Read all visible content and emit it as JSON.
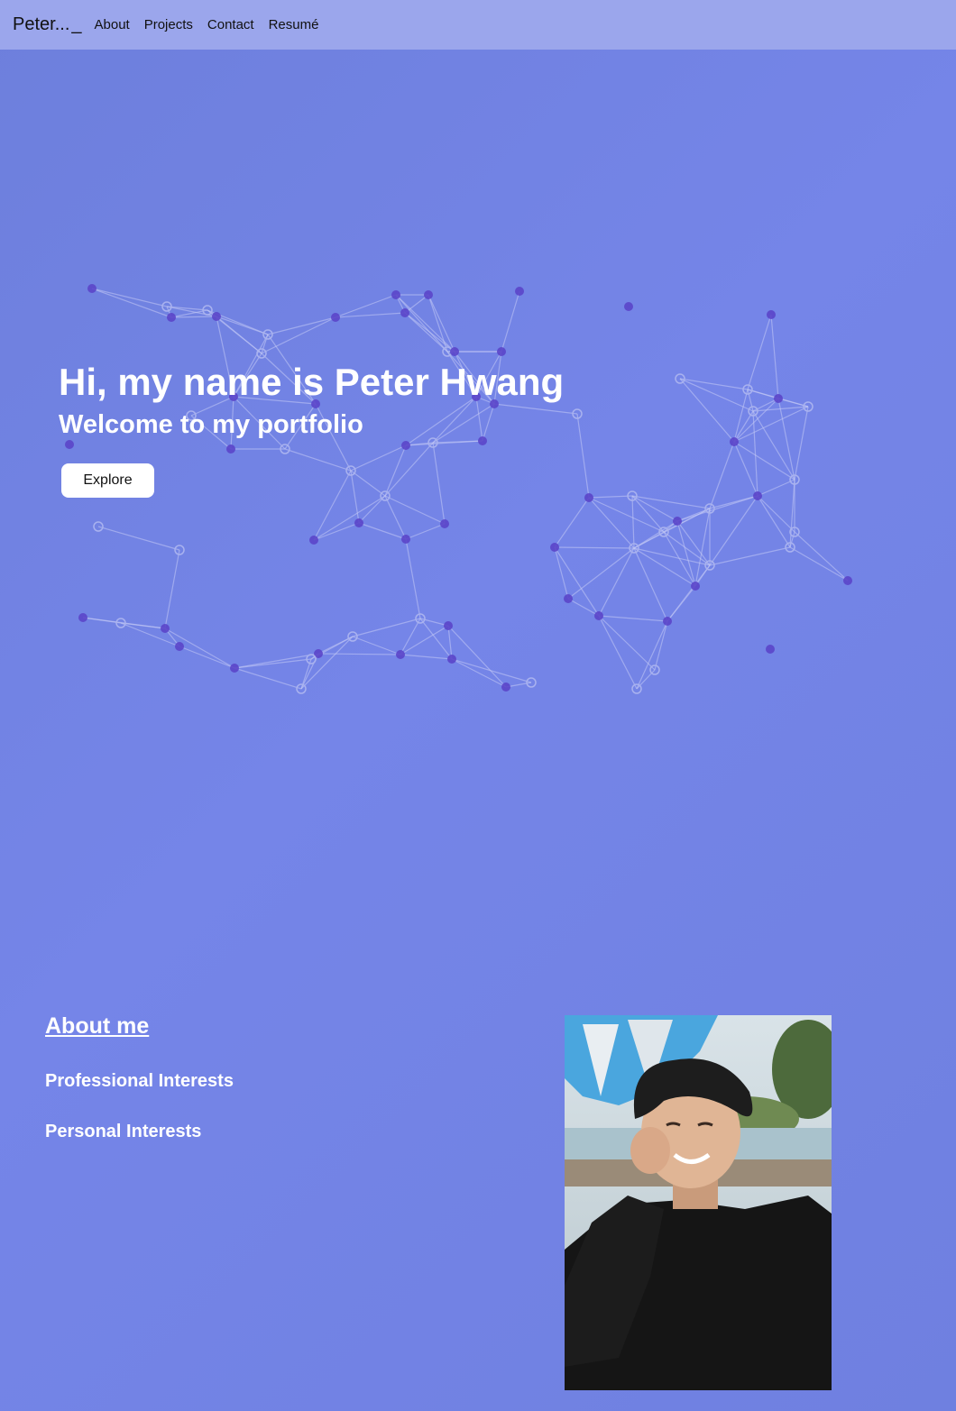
{
  "navbar": {
    "brand": "Peter...",
    "cursor": "_",
    "links": [
      "About",
      "Projects",
      "Contact",
      "Resumé"
    ]
  },
  "hero": {
    "title": "Hi, my name is Peter Hwang",
    "subtitle": "Welcome to my portfolio",
    "button_label": "Explore"
  },
  "about": {
    "title": "About me",
    "professional": "Professional Interests",
    "personal": "Personal Interests"
  },
  "colors": {
    "background": "#7382e4",
    "navbar": "#9ba6ec",
    "node_filled": "#5b45c9",
    "node_hollow": "#a9b2ef"
  }
}
